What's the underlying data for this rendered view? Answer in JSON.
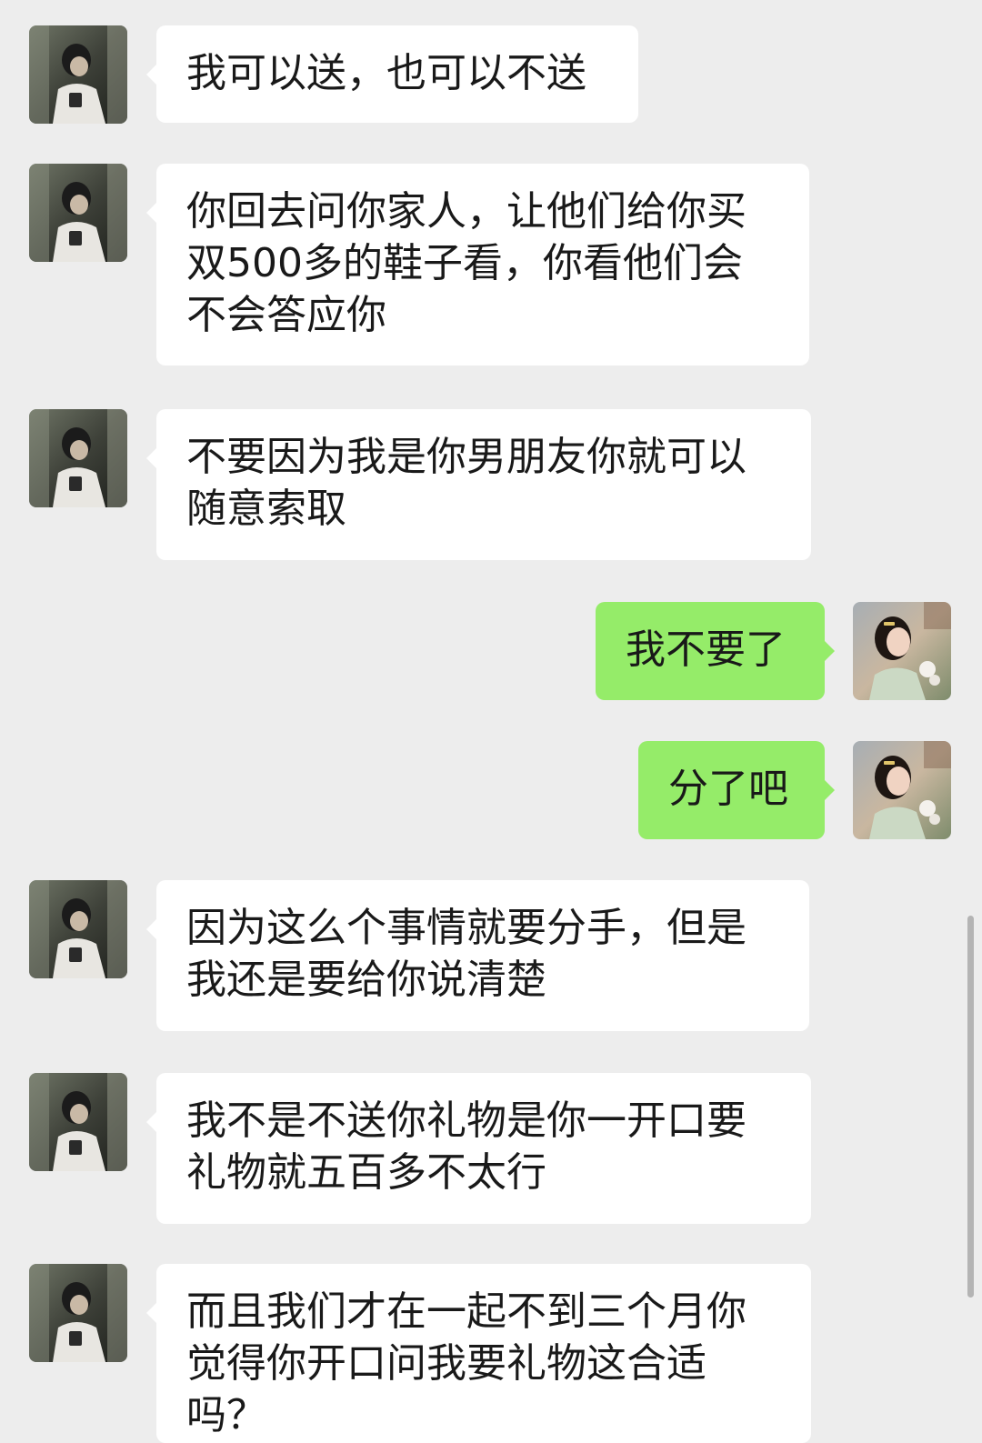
{
  "chat": {
    "messages": [
      {
        "sender": "boyfriend",
        "text": "我可以送，也可以不送"
      },
      {
        "sender": "boyfriend",
        "text": "你回去问你家人，让他们给你买双500多的鞋子看，你看他们会不会答应你"
      },
      {
        "sender": "boyfriend",
        "text": "不要因为我是你男朋友你就可以随意索取"
      },
      {
        "sender": "me",
        "text": "我不要了"
      },
      {
        "sender": "me",
        "text": "分了吧"
      },
      {
        "sender": "boyfriend",
        "text": "因为这么个事情就要分手，但是我还是要给你说清楚"
      },
      {
        "sender": "boyfriend",
        "text": "我不是不送你礼物是你一开口要礼物就五百多不太行"
      },
      {
        "sender": "boyfriend",
        "text": "而且我们才在一起不到三个月你觉得你开口问我要礼物这合适吗？"
      }
    ]
  },
  "colors": {
    "background": "#ededed",
    "incoming_bubble": "#ffffff",
    "outgoing_bubble": "#95ec69",
    "text": "#191919"
  },
  "icons": {
    "contact_avatar": "boyfriend-avatar-icon",
    "self_avatar": "self-avatar-icon"
  }
}
